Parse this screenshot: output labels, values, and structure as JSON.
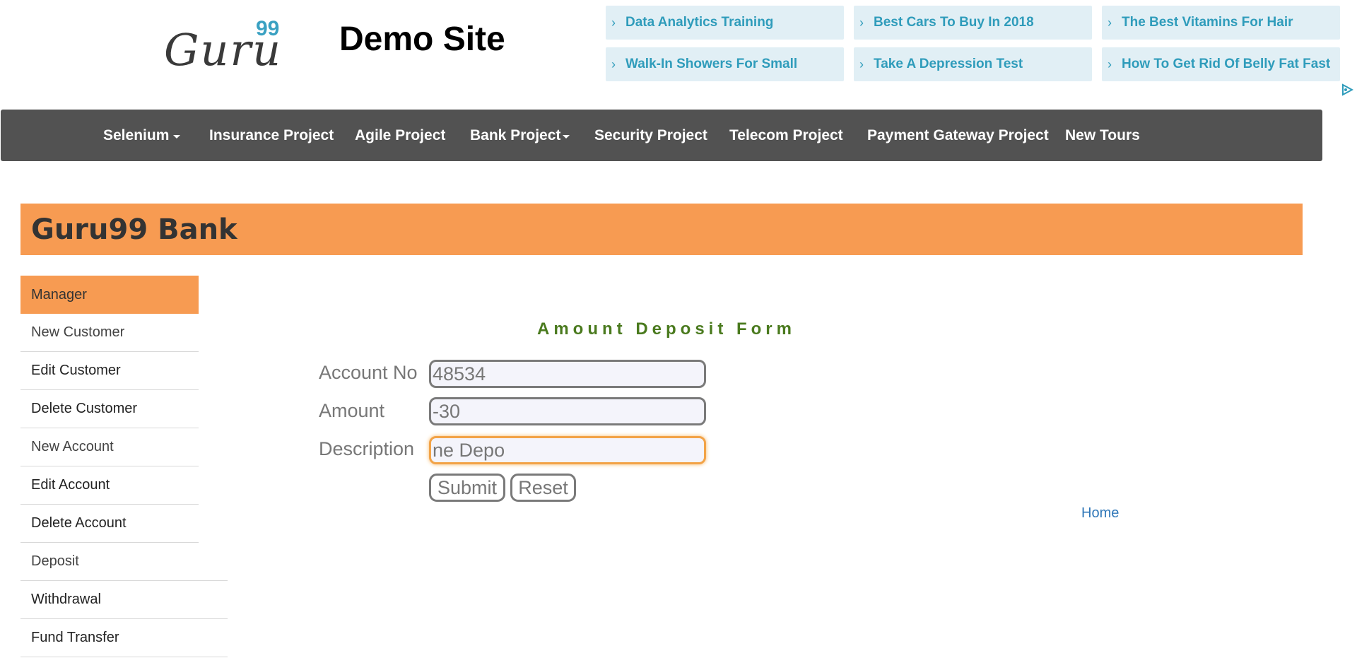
{
  "header": {
    "logo_word": "Guru",
    "logo_number": "99",
    "site_title": "Demo Site"
  },
  "ads": [
    {
      "label": "Data Analytics Training"
    },
    {
      "label": "Best Cars To Buy In 2018"
    },
    {
      "label": "The Best Vitamins For Hair"
    },
    {
      "label": "Walk-In Showers For Small"
    },
    {
      "label": "Take A Depression Test"
    },
    {
      "label": "How To Get Rid Of Belly Fat Fast"
    }
  ],
  "nav": {
    "items": [
      {
        "label": "Selenium"
      },
      {
        "label": "Insurance Project"
      },
      {
        "label": "Agile Project"
      },
      {
        "label": "Bank Project"
      },
      {
        "label": "Security Project"
      },
      {
        "label": "Telecom Project"
      },
      {
        "label": "Payment Gateway Project"
      },
      {
        "label": "New Tours"
      }
    ]
  },
  "bank": {
    "title": "Guru99 Bank"
  },
  "sidebar": {
    "items": [
      {
        "label": "Manager"
      },
      {
        "label": "New Customer"
      },
      {
        "label": "Edit Customer"
      },
      {
        "label": "Delete Customer"
      },
      {
        "label": "New Account"
      },
      {
        "label": "Edit Account"
      },
      {
        "label": "Delete Account"
      },
      {
        "label": "Deposit"
      },
      {
        "label": "Withdrawal"
      },
      {
        "label": "Fund Transfer"
      }
    ]
  },
  "form": {
    "title": "Amount Deposit Form",
    "account_label": "Account No",
    "account_value": "48534",
    "amount_label": "Amount",
    "amount_value": "-30",
    "description_label": "Description",
    "description_value": "ne Depo",
    "submit_label": "Submit",
    "reset_label": "Reset"
  },
  "links": {
    "home": "Home"
  },
  "colors": {
    "accent": "#f79b52",
    "nav_bg": "#525252",
    "form_title": "#4a7a1e",
    "ad_text": "#2f9cbb",
    "link": "#2f77b8"
  }
}
